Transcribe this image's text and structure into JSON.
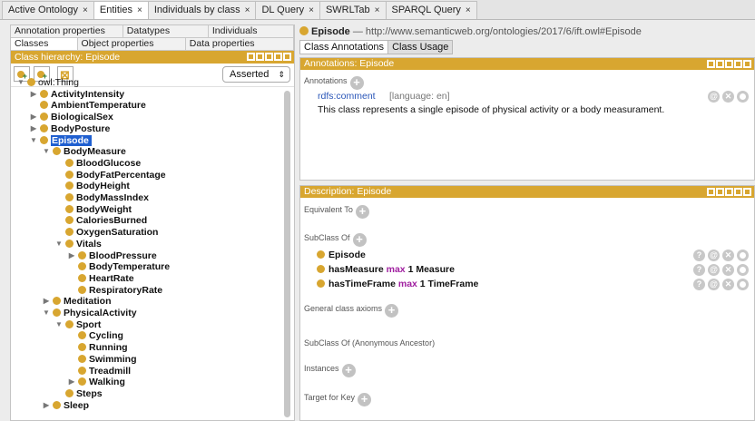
{
  "tabs": [
    {
      "label": "Active Ontology",
      "active": false
    },
    {
      "label": "Entities",
      "active": true
    },
    {
      "label": "Individuals by class",
      "active": false
    },
    {
      "label": "DL Query",
      "active": false
    },
    {
      "label": "SWRLTab",
      "active": false
    },
    {
      "label": "SPARQL Query",
      "active": false
    }
  ],
  "tab_close": "×",
  "left": {
    "subtabs_row1": [
      "Annotation properties",
      "Datatypes",
      "Individuals"
    ],
    "subtabs_row2": [
      "Classes",
      "Object properties",
      "Data properties"
    ],
    "hierarchy_title": "Class hierarchy: Episode",
    "view_mode": "Asserted",
    "tree": [
      {
        "label": "owl:Thing",
        "level": 0,
        "toggle": "open",
        "plain": true
      },
      {
        "label": "ActivityIntensity",
        "level": 1,
        "toggle": "closed"
      },
      {
        "label": "AmbientTemperature",
        "level": 1,
        "toggle": ""
      },
      {
        "label": "BiologicalSex",
        "level": 1,
        "toggle": "closed"
      },
      {
        "label": "BodyPosture",
        "level": 1,
        "toggle": "closed"
      },
      {
        "label": "Episode",
        "level": 1,
        "toggle": "open",
        "selected": true
      },
      {
        "label": "BodyMeasure",
        "level": 2,
        "toggle": "open"
      },
      {
        "label": "BloodGlucose",
        "level": 3,
        "toggle": ""
      },
      {
        "label": "BodyFatPercentage",
        "level": 3,
        "toggle": ""
      },
      {
        "label": "BodyHeight",
        "level": 3,
        "toggle": ""
      },
      {
        "label": "BodyMassIndex",
        "level": 3,
        "toggle": ""
      },
      {
        "label": "BodyWeight",
        "level": 3,
        "toggle": ""
      },
      {
        "label": "CaloriesBurned",
        "level": 3,
        "toggle": ""
      },
      {
        "label": "OxygenSaturation",
        "level": 3,
        "toggle": ""
      },
      {
        "label": "Vitals",
        "level": 3,
        "toggle": "open"
      },
      {
        "label": "BloodPressure",
        "level": 4,
        "toggle": "closed"
      },
      {
        "label": "BodyTemperature",
        "level": 4,
        "toggle": ""
      },
      {
        "label": "HeartRate",
        "level": 4,
        "toggle": ""
      },
      {
        "label": "RespiratoryRate",
        "level": 4,
        "toggle": ""
      },
      {
        "label": "Meditation",
        "level": 2,
        "toggle": "closed"
      },
      {
        "label": "PhysicalActivity",
        "level": 2,
        "toggle": "open"
      },
      {
        "label": "Sport",
        "level": 3,
        "toggle": "open"
      },
      {
        "label": "Cycling",
        "level": 4,
        "toggle": ""
      },
      {
        "label": "Running",
        "level": 4,
        "toggle": ""
      },
      {
        "label": "Swimming",
        "level": 4,
        "toggle": ""
      },
      {
        "label": "Treadmill",
        "level": 4,
        "toggle": ""
      },
      {
        "label": "Walking",
        "level": 4,
        "toggle": "closed"
      },
      {
        "label": "Steps",
        "level": 3,
        "toggle": ""
      },
      {
        "label": "Sleep",
        "level": 2,
        "toggle": "closed"
      }
    ]
  },
  "right": {
    "entity_name": "Episode",
    "entity_iri": " — http://www.semanticweb.org/ontologies/2017/6/ift.owl#Episode",
    "tabs": [
      "Class Annotations",
      "Class Usage"
    ],
    "annotations_title": "Annotations: Episode",
    "annotations_label": "Annotations",
    "annotation": {
      "property": "rdfs:comment",
      "language": "[language: en]",
      "value": "This class represents a single episode of physical activity or a body measurament."
    },
    "description_title": "Description: Episode",
    "equivalent_to": "Equivalent To",
    "subclass_of": "SubClass Of",
    "subclasses": [
      {
        "name": "Episode",
        "keyword": "",
        "rest": ""
      },
      {
        "name": "hasMeasure",
        "keyword": "max",
        "rest": "1 Measure"
      },
      {
        "name": "hasTimeFrame",
        "keyword": "max",
        "rest": "1 TimeFrame"
      }
    ],
    "general_axioms": "General class axioms",
    "anon_ancestor": "SubClass Of (Anonymous Ancestor)",
    "instances": "Instances",
    "target_for_key": "Target for Key"
  },
  "colors": {
    "accent": "#d8a630",
    "selection": "#1f5fd0",
    "keyword": "#a020a0",
    "property": "#2a56b8"
  }
}
